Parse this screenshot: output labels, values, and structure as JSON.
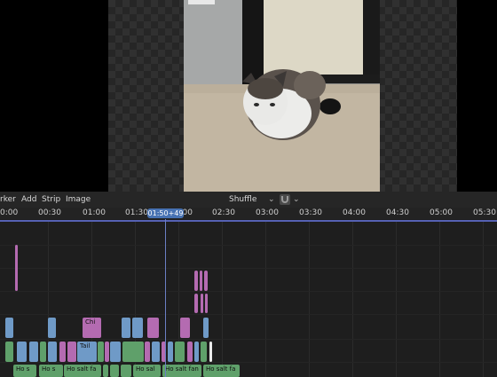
{
  "menu": {
    "marker": "rker",
    "add": "Add",
    "strip": "Strip",
    "image": "Image"
  },
  "header": {
    "mode": "Shuffle"
  },
  "ruler": {
    "ticks": [
      "0:00",
      "00:30",
      "01:00",
      "01:30",
      "02:00",
      "02:30",
      "03:00",
      "03:30",
      "04:00",
      "04:30",
      "05:00",
      "05:30"
    ],
    "playhead": "01:50+49"
  },
  "strips": {
    "chi": "Chi",
    "tail": "Tail",
    "ho_s_1": "Ho s",
    "ho_s_2": "Ho s",
    "ho_salt_fa": "Ho salt fa",
    "ho_sal": "Ho sal",
    "ho_salt_fan": "Ho salt fan",
    "ho_salt_fa_2": "Ho salt fa"
  },
  "colors": {
    "accent": "#4772b3",
    "image_strip": "#6f9ac7",
    "color_strip": "#b46bb1",
    "sound_strip": "#5fa06a"
  }
}
